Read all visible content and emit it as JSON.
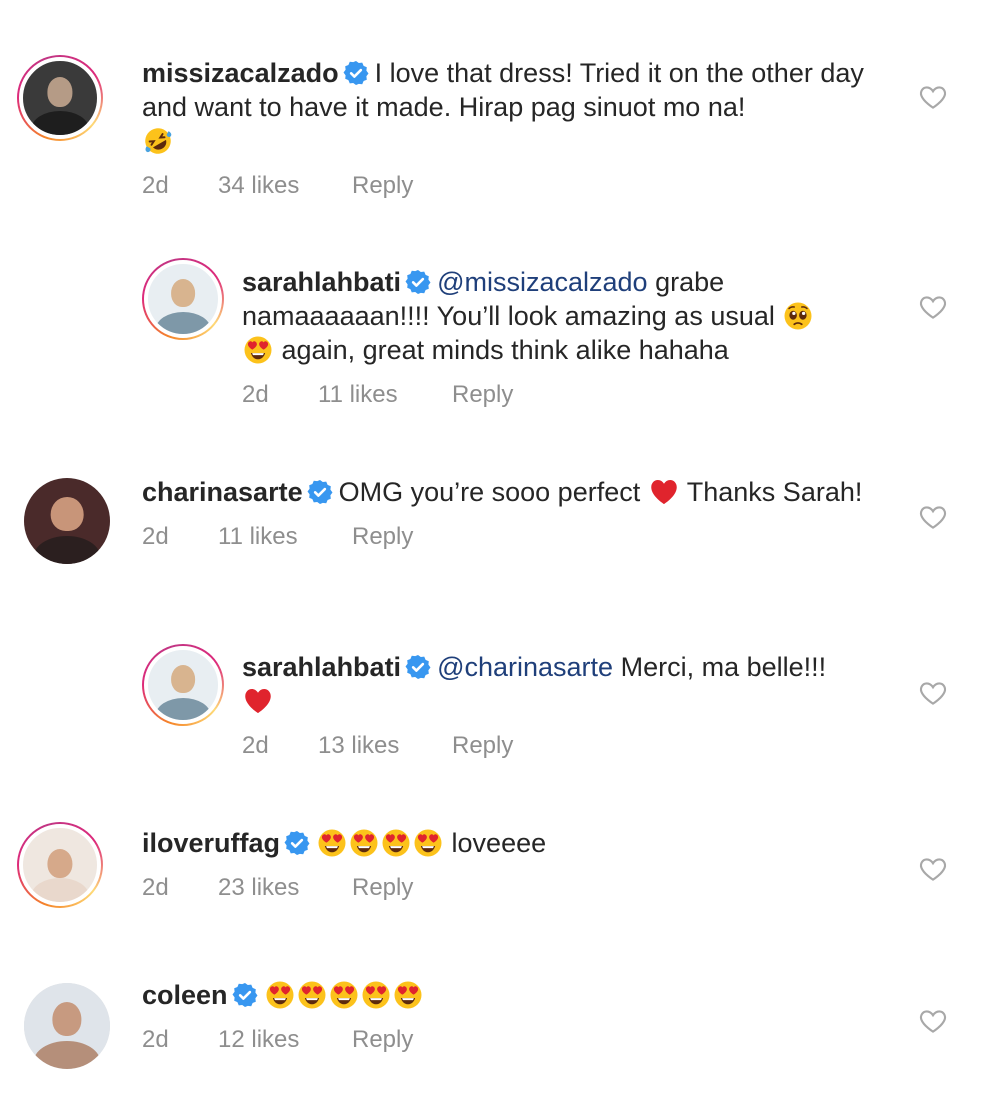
{
  "comments": [
    {
      "username": "missizacalzado",
      "text": "I love that dress! Tried it on the other day and want to have it made. Hirap pag sinuot mo na!",
      "emoji": [
        "rofl-emoji"
      ],
      "time": "2d",
      "likes": "34 likes",
      "reply": "Reply"
    },
    {
      "username": "sarahlahbati",
      "mention": "@missizacalzado",
      "text": "grabe namaaaaaan!!!! You’ll look amazing as usual",
      "emoji_after_text": [
        "pleading-emoji"
      ],
      "text2": "again, great minds think alike hahaha",
      "emoji_before_text2": [
        "heart-eyes-emoji"
      ],
      "time": "2d",
      "likes": "11 likes",
      "reply": "Reply"
    },
    {
      "username": "charinasarte",
      "text": "OMG you’re sooo perfect",
      "emoji_after_text": [
        "red-heart-emoji"
      ],
      "text2": "Thanks Sarah!",
      "time": "2d",
      "likes": "11 likes",
      "reply": "Reply"
    },
    {
      "username": "sarahlahbati",
      "mention": "@charinasarte",
      "text": "Merci, ma belle!!!",
      "emoji": [
        "red-heart-emoji"
      ],
      "time": "2d",
      "likes": "13 likes",
      "reply": "Reply"
    },
    {
      "username": "iloveruffag",
      "emoji": [
        "heart-eyes-emoji",
        "heart-eyes-emoji",
        "heart-eyes-emoji",
        "heart-eyes-emoji"
      ],
      "text": "loveeee",
      "time": "2d",
      "likes": "23 likes",
      "reply": "Reply"
    },
    {
      "username": "coleen",
      "emoji": [
        "heart-eyes-emoji",
        "heart-eyes-emoji",
        "heart-eyes-emoji",
        "heart-eyes-emoji",
        "heart-eyes-emoji"
      ],
      "time": "2d",
      "likes": "12 likes",
      "reply": "Reply"
    }
  ],
  "icons": {
    "verified": "verified-badge-icon",
    "like": "heart-outline-icon"
  },
  "colors": {
    "verified_blue": "#3897f0",
    "mention": "#1f3f7a",
    "meta_gray": "#8e8e8e",
    "heart_red": "#e0242d"
  }
}
